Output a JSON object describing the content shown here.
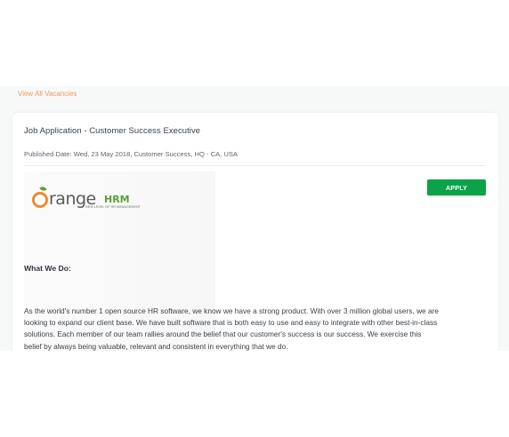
{
  "vacancies_link": "View All Vacancies",
  "job": {
    "title": "Job Application - Customer Success Executive",
    "meta": "Published Date: Wed, 23 May 2018, Customer Success, HQ - CA, USA",
    "apply_label": "APPLY"
  },
  "logo": {
    "letter": "O",
    "brand_text": "range",
    "brand_suffix": "HRM",
    "tagline": "NEW LEVEL OF HR MANAGEMENT"
  },
  "section": {
    "heading": "What We Do:",
    "lines": [
      "As the world's number 1 open source HR software, we know we have a strong product. With over 3 million global users, we are",
      "looking to expand our client base. We have built software that is both easy to use and easy to integrate with other best-in-class",
      "solutions. Each member of our team rallies around the belief that our customer's success is our success. We exercise this",
      "belief by always being valuable, relevant and consistent in everything that we do."
    ]
  },
  "colors": {
    "accent_link": "#f09a5a",
    "apply_button": "#0ca24a",
    "brand_orange": "#f08a2a",
    "brand_green": "#57a33a"
  }
}
